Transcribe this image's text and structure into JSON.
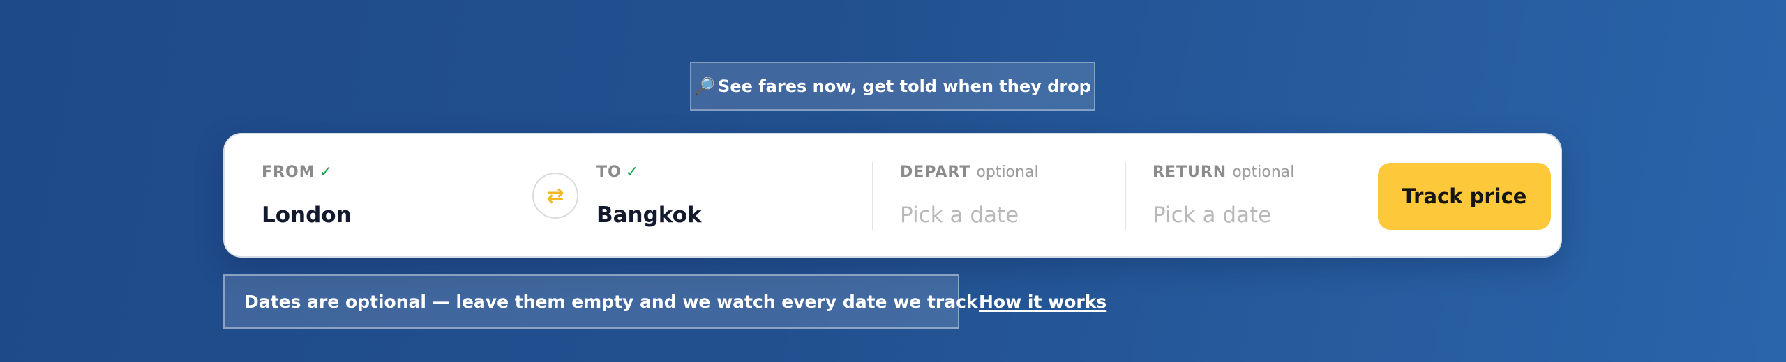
{
  "banner": {
    "icon": "magnifier-icon",
    "icon_glyph": "🔎",
    "text": "See fares now, get told when they drop"
  },
  "search": {
    "from": {
      "label": "FROM",
      "check": "✓",
      "value": "London"
    },
    "to": {
      "label": "TO",
      "check": "✓",
      "value": "Bangkok"
    },
    "swap": {
      "icon": "swap-arrows-icon",
      "glyph": "⇄"
    },
    "depart": {
      "label": "DEPART",
      "optional": "optional",
      "placeholder": "Pick a date"
    },
    "return": {
      "label": "RETURN",
      "optional": "optional",
      "placeholder": "Pick a date"
    },
    "submit_label": "Track price"
  },
  "footer": {
    "note": "Dates are optional — leave them empty and we watch every date we track",
    "link": "How it works"
  },
  "colors": {
    "background": "#22508f",
    "accent_button": "#fdc839",
    "check": "#1aa14a",
    "swap_icon": "#f3b81f"
  }
}
